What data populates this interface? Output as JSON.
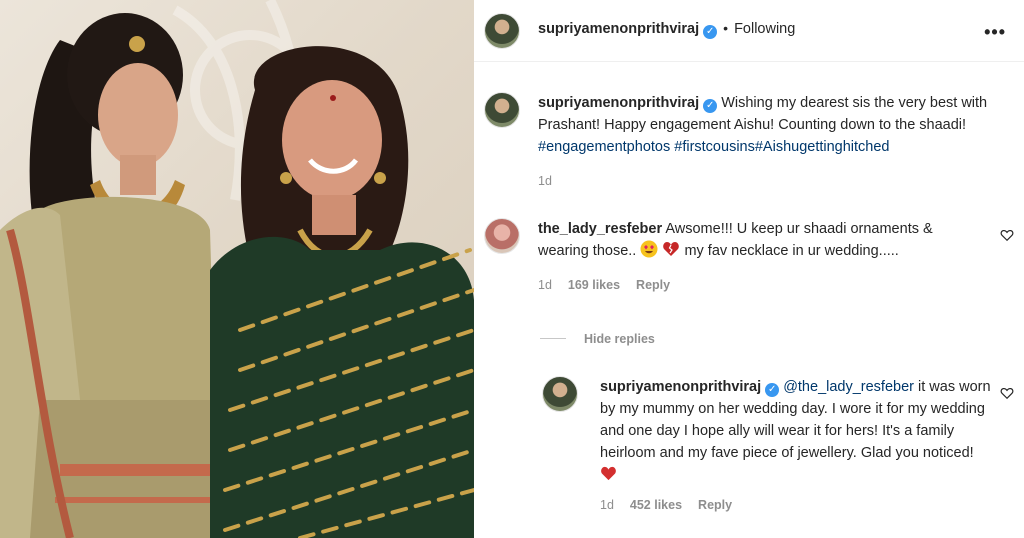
{
  "post": {
    "username": "supriyamenonprithviraj",
    "follow_status": "Following",
    "more_icon": "more-options-icon"
  },
  "caption": {
    "username": "supriyamenonprithviraj",
    "text": "Wishing my dearest sis the very best with Prashant! Happy engagement Aishu! Counting down to the shaadi!",
    "hashtags": [
      "#engagementphotos",
      "#firstcousins",
      "#Aishugettinghitched"
    ],
    "time": "1d"
  },
  "comment": {
    "username": "the_lady_resfeber",
    "text_before_emoji": "Awsome!!! U keep ur shaadi ornaments & wearing those..",
    "text_after_emoji": "my fav necklace in ur wedding.....",
    "time": "1d",
    "likes": "169 likes",
    "reply_label": "Reply"
  },
  "hide_replies_label": "Hide replies",
  "reply": {
    "username": "supriyamenonprithviraj",
    "mention": "@the_lady_resfeber",
    "text": "it was worn by my mummy on her wedding day. I wore it for my wedding and one day I hope ally will wear it for hers! It's a family heirloom and my fave piece of jewellery. Glad you noticed!",
    "time": "1d",
    "likes": "452 likes",
    "reply_label": "Reply"
  },
  "colors": {
    "verified": "#3897f0",
    "hashtag": "#00376b",
    "meta": "#8e8e8e",
    "heart_emoji": "#d32f2f"
  }
}
